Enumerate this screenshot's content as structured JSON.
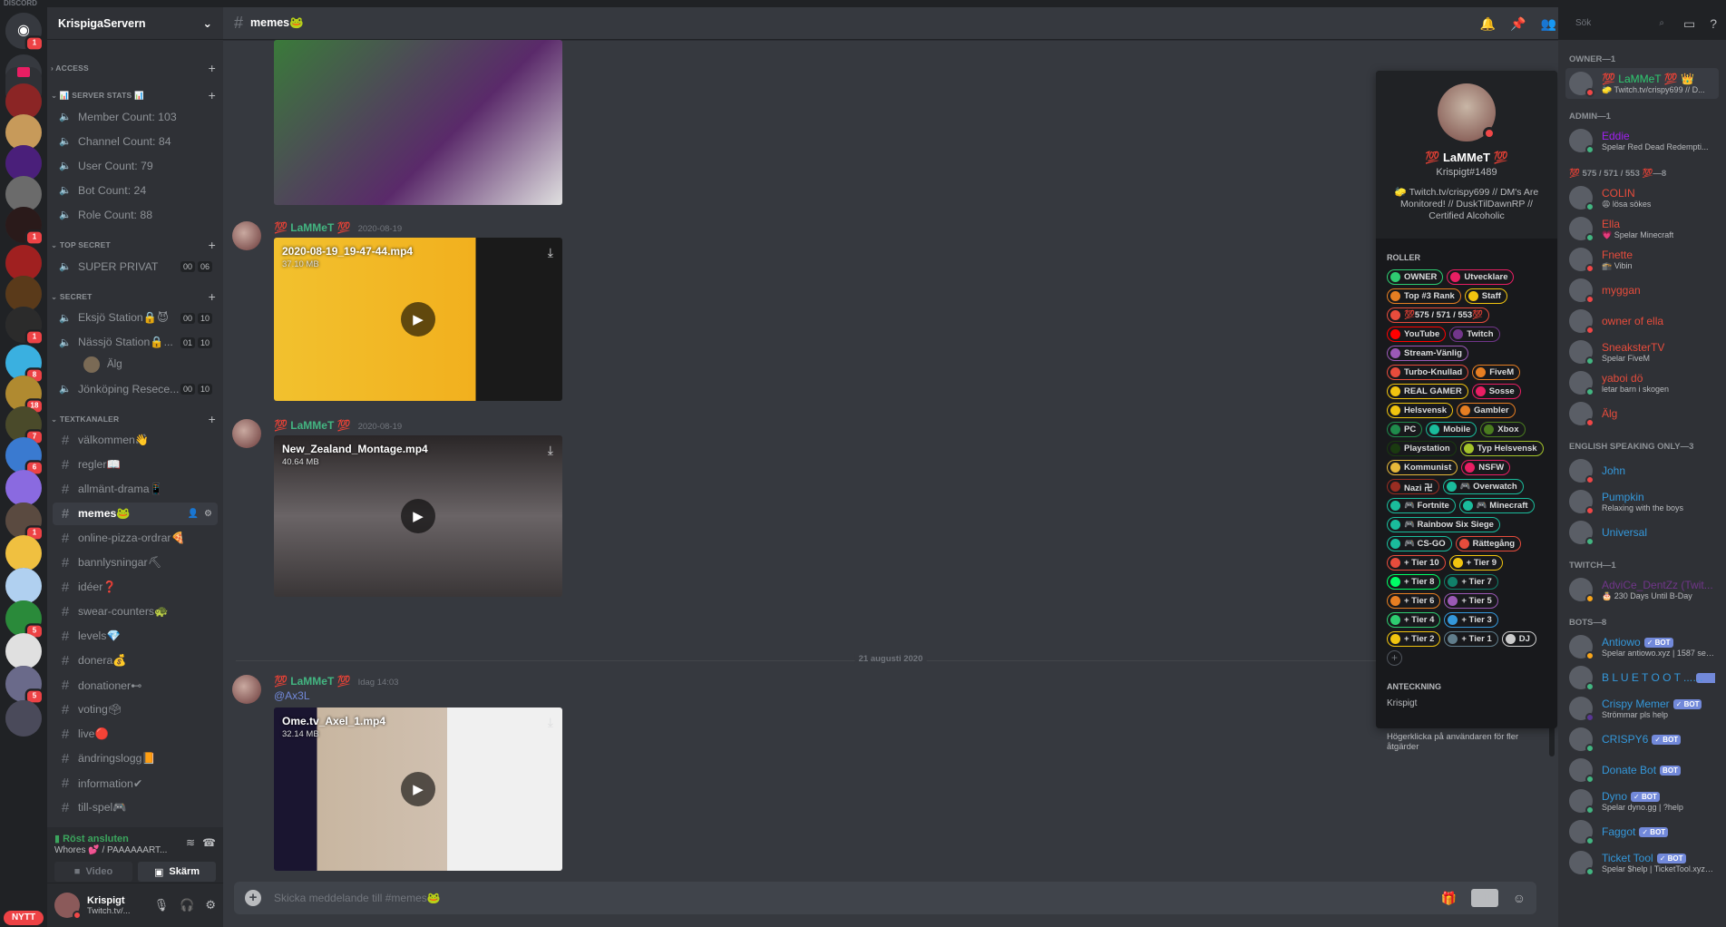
{
  "app": {
    "title": "DISCORD"
  },
  "guilds": [
    {
      "name": "home",
      "color": "#36393f",
      "badge": "1"
    },
    {
      "name": "folder",
      "color": "#e91e63",
      "badge": null
    },
    {
      "name": "server-red",
      "color": "#8b2525",
      "badge": null
    },
    {
      "name": "server-monkey",
      "color": "#c79a5a",
      "badge": null
    },
    {
      "name": "server-dusk",
      "color": "#4a1f7a",
      "badge": null
    },
    {
      "name": "server-car",
      "color": "#6b6b6b",
      "badge": null
    },
    {
      "name": "server-dark",
      "color": "#2a1a1a",
      "badge": "1"
    },
    {
      "name": "server-red2",
      "color": "#a02020",
      "badge": null
    },
    {
      "name": "server-bigboss",
      "color": "#5a3a1a",
      "badge": null
    },
    {
      "name": "server-tidepool",
      "color": "#2b2b2b",
      "badge": "1"
    },
    {
      "name": "server-lame",
      "color": "#3ab0e0",
      "badge": "8"
    },
    {
      "name": "server-ash",
      "color": "#b08a30",
      "badge": "18"
    },
    {
      "name": "server-shreks",
      "color": "#4a4a2a",
      "badge": "7"
    },
    {
      "name": "server-fortnite",
      "color": "#3a7ad0",
      "badge": "6"
    },
    {
      "name": "server-purple",
      "color": "#8a6ae0",
      "badge": null
    },
    {
      "name": "server-hand",
      "color": "#5a4a40",
      "badge": "1"
    },
    {
      "name": "server-sad",
      "color": "#f0c040",
      "badge": null
    },
    {
      "name": "server-blue",
      "color": "#b0d0f0",
      "badge": null
    },
    {
      "name": "server-monopoly",
      "color": "#2a8a3a",
      "badge": "5"
    },
    {
      "name": "server-rainbow",
      "color": "#e0e0e0",
      "badge": null
    },
    {
      "name": "server-ms",
      "color": "#6a6a8a",
      "badge": "5"
    },
    {
      "name": "server-dark2",
      "color": "#4a4a5a",
      "badge": null
    }
  ],
  "nytt_label": "NYTT",
  "server": {
    "name": "KrispigaServern"
  },
  "categories": [
    {
      "name": "ACCESS",
      "collapsed": true,
      "channels": []
    },
    {
      "name": "📊 SERVER STATS 📊",
      "collapsed": false,
      "channels": [
        {
          "type": "voice",
          "name": "Member Count: 103"
        },
        {
          "type": "voice",
          "name": "Channel Count: 84"
        },
        {
          "type": "voice",
          "name": "User Count: 79"
        },
        {
          "type": "voice",
          "name": "Bot Count: 24"
        },
        {
          "type": "voice",
          "name": "Role Count: 88"
        }
      ]
    },
    {
      "name": "TOP SECRET",
      "collapsed": false,
      "channels": [
        {
          "type": "voice",
          "name": "SUPER PRIVAT",
          "count_a": "00",
          "count_b": "06"
        }
      ]
    },
    {
      "name": "SECRET",
      "collapsed": false,
      "channels": [
        {
          "type": "voice",
          "name": "Eksjö Station🔒😈",
          "count_a": "00",
          "count_b": "10"
        },
        {
          "type": "voice",
          "name": "Nässjö Station🔒...",
          "count_a": "01",
          "count_b": "10",
          "users": [
            "Älg"
          ]
        },
        {
          "type": "voice",
          "name": "Jönköping Resece...",
          "count_a": "00",
          "count_b": "10"
        }
      ]
    },
    {
      "name": "TEXTKANALER",
      "collapsed": false,
      "channels": [
        {
          "type": "text",
          "name": "välkommen👋"
        },
        {
          "type": "text",
          "name": "regler📖"
        },
        {
          "type": "text",
          "name": "allmänt-drama📱"
        },
        {
          "type": "text",
          "name": "memes🐸",
          "active": true
        },
        {
          "type": "text",
          "name": "online-pizza-ordrar🍕"
        },
        {
          "type": "text",
          "name": "bannlysningar⛏"
        },
        {
          "type": "text",
          "name": "idéer❓"
        },
        {
          "type": "text",
          "name": "swear-counters🐢"
        },
        {
          "type": "text",
          "name": "levels💎"
        },
        {
          "type": "text",
          "name": "donera💰"
        },
        {
          "type": "text",
          "name": "donationer⊷"
        },
        {
          "type": "text",
          "name": "voting🗳"
        },
        {
          "type": "text",
          "name": "live🔴"
        },
        {
          "type": "text",
          "name": "ändringslogg📙"
        },
        {
          "type": "text",
          "name": "information✔"
        },
        {
          "type": "text",
          "name": "till-spel🎮"
        }
      ]
    }
  ],
  "voice_panel": {
    "status": "Röst ansluten",
    "channel": "Whores 💕 / PAAAAAART...",
    "video_label": "Video",
    "screen_label": "Skärm"
  },
  "user_panel": {
    "name": "Krispigt",
    "status": "Twitch.tv/..."
  },
  "channel_header": {
    "name": "memes🐸",
    "search_placeholder": "Sök"
  },
  "messages": [
    {
      "author": "💯 LaMMeT 💯",
      "timestamp": "2020-08-19",
      "attachment": {
        "filename": "2020-08-19_19-47-44.mp4",
        "size": "37.10 MB"
      }
    },
    {
      "author": "💯 LaMMeT 💯",
      "timestamp": "2020-08-19",
      "attachment": {
        "filename": "New_Zealand_Montage.mp4",
        "size": "40.64 MB"
      }
    },
    {
      "author": "💯 LaMMeT 💯",
      "timestamp": "Idag 14:03",
      "mention": "@Ax3L",
      "attachment": {
        "filename": "Ome.tv_Axel_1.mp4",
        "size": "32.14 MB"
      }
    }
  ],
  "date_divider": "21 augusti 2020",
  "composer": {
    "placeholder": "Skicka meddelande till #memes🐸"
  },
  "profile": {
    "name": "💯 LaMMeT 💯",
    "tag": "Krispigt#1489",
    "bio": "🧽 Twitch.tv/crispy699 // DM's Are Monitored! // DuskTilDawnRP // Certified Alcoholic",
    "roles_label": "ROLLER",
    "roles": [
      {
        "name": "OWNER",
        "color": "#2ecc71"
      },
      {
        "name": "Utvecklare",
        "color": "#e91e63"
      },
      {
        "name": "Top #3 Rank",
        "color": "#e67e22"
      },
      {
        "name": "Staff",
        "color": "#f1c40f"
      },
      {
        "name": "💯575 / 571 / 553💯",
        "color": "#e74c3c"
      },
      {
        "name": "YouTube",
        "color": "#ff0000"
      },
      {
        "name": "Twitch",
        "color": "#71368a"
      },
      {
        "name": "Stream-Vänlig",
        "color": "#9b59b6"
      },
      {
        "name": "Turbo-Knullad",
        "color": "#e74c3c"
      },
      {
        "name": "FiveM",
        "color": "#e67e22"
      },
      {
        "name": "REAL GAMER",
        "color": "#f1c40f"
      },
      {
        "name": "Sosse",
        "color": "#e91e63"
      },
      {
        "name": "Helsvensk",
        "color": "#f1c40f"
      },
      {
        "name": "Gambler",
        "color": "#e67e22"
      },
      {
        "name": "PC",
        "color": "#1f8b4c"
      },
      {
        "name": "Mobile",
        "color": "#1abc9c"
      },
      {
        "name": "Xbox",
        "color": "#4a7c1f"
      },
      {
        "name": "Playstation",
        "color": "#1a3a10"
      },
      {
        "name": "Typ Helsvensk",
        "color": "#a4c42a"
      },
      {
        "name": "Kommunist",
        "color": "#e6b83a"
      },
      {
        "name": "NSFW",
        "color": "#e91e63"
      },
      {
        "name": "Nazi 卍",
        "color": "#992d22"
      },
      {
        "name": "🎮 Overwatch",
        "color": "#1abc9c"
      },
      {
        "name": "🎮 Fortnite",
        "color": "#1abc9c"
      },
      {
        "name": "🎮 Minecraft",
        "color": "#1abc9c"
      },
      {
        "name": "🎮 Rainbow Six Siege",
        "color": "#1abc9c"
      },
      {
        "name": "🎮 CS-GO",
        "color": "#1abc9c"
      },
      {
        "name": "Rättegång",
        "color": "#e74c3c"
      },
      {
        "name": "+ Tier 10",
        "color": "#e74c3c"
      },
      {
        "name": "+ Tier 9",
        "color": "#f1c40f"
      },
      {
        "name": "+ Tier 8",
        "color": "#00ff66"
      },
      {
        "name": "+ Tier 7",
        "color": "#11806a"
      },
      {
        "name": "+ Tier 6",
        "color": "#e67e22"
      },
      {
        "name": "+ Tier 5",
        "color": "#9b59b6"
      },
      {
        "name": "+ Tier 4",
        "color": "#2ecc71"
      },
      {
        "name": "+ Tier 3",
        "color": "#3498db"
      },
      {
        "name": "+ Tier 2",
        "color": "#f1c40f"
      },
      {
        "name": "+ Tier 1",
        "color": "#607d8b"
      },
      {
        "name": "DJ",
        "color": "#cccccc"
      }
    ],
    "note_label": "ANTECKNING",
    "note": "Krispigt",
    "hint": "Högerklicka på användaren för fler åtgärder"
  },
  "member_groups": [
    {
      "name": "OWNER—1",
      "members": [
        {
          "name": "💯 LaMMeT 💯 👑",
          "color": "#2ecc71",
          "activity": "🧽 Twitch.tv/crispy699 // D...",
          "status": "dnd",
          "selected": true
        }
      ]
    },
    {
      "name": "ADMIN—1",
      "members": [
        {
          "name": "Eddie",
          "color": "#a020f0",
          "activity": "Spelar Red Dead Redempti...",
          "status": "online"
        }
      ]
    },
    {
      "name": "💯 575 / 571 / 553 💯—8",
      "members": [
        {
          "name": "COLIN",
          "color": "#e74c3c",
          "activity": "😩 lösa sökes",
          "status": "online"
        },
        {
          "name": "Ella",
          "color": "#e74c3c",
          "activity": "💗 Spelar Minecraft",
          "status": "online"
        },
        {
          "name": "Fnette",
          "color": "#e74c3c",
          "activity": "🕋 Vibin",
          "status": "dnd"
        },
        {
          "name": "myggan",
          "color": "#e74c3c",
          "activity": "",
          "status": "dnd"
        },
        {
          "name": "owner of ella",
          "color": "#e74c3c",
          "activity": "",
          "status": "dnd"
        },
        {
          "name": "SneaksterTV",
          "color": "#e74c3c",
          "activity": "Spelar FiveM",
          "status": "online"
        },
        {
          "name": "yaboi dö",
          "color": "#e74c3c",
          "activity": "letar barn i skogen",
          "status": "online"
        },
        {
          "name": "Älg",
          "color": "#e74c3c",
          "activity": "",
          "status": "dnd"
        }
      ]
    },
    {
      "name": "ENGLISH SPEAKING ONLY—3",
      "members": [
        {
          "name": "John",
          "color": "#3498db",
          "activity": "",
          "status": "dnd"
        },
        {
          "name": "Pumpkin",
          "color": "#3498db",
          "activity": "Relaxing with the boys",
          "status": "dnd"
        },
        {
          "name": "Universal",
          "color": "#3498db",
          "activity": "",
          "status": "online"
        }
      ]
    },
    {
      "name": "TWITCH—1",
      "members": [
        {
          "name": "AdviCe_DentZz (Twit...",
          "color": "#71368a",
          "activity": "🎂 230 Days Until B-Day",
          "status": "idle"
        }
      ]
    },
    {
      "name": "BOTS—8",
      "members": [
        {
          "name": "Antiowo",
          "color": "#3498db",
          "activity": "Spelar antiowo.xyz | 1587 serv...",
          "status": "idle",
          "bot": "✓ BOT"
        },
        {
          "name": "B L U E T O O T ...",
          "color": "#3498db",
          "activity": "",
          "status": "online",
          "bot": "✓ BOT"
        },
        {
          "name": "Crispy Memer",
          "color": "#3498db",
          "activity": "Strömmar pls help",
          "status": "stream",
          "bot": "✓ BOT"
        },
        {
          "name": "CRISPY6",
          "color": "#3498db",
          "activity": "",
          "status": "online",
          "bot": "✓ BOT"
        },
        {
          "name": "Donate Bot",
          "color": "#3498db",
          "activity": "",
          "status": "online",
          "bot": "BOT"
        },
        {
          "name": "Dyno",
          "color": "#3498db",
          "activity": "Spelar dyno.gg | ?help",
          "status": "online",
          "bot": "✓ BOT"
        },
        {
          "name": "Faggot",
          "color": "#3498db",
          "activity": "",
          "status": "online",
          "bot": "✓ BOT"
        },
        {
          "name": "Ticket Tool",
          "color": "#3498db",
          "activity": "Spelar $help | TicketTool.xyz | ...",
          "status": "online",
          "bot": "✓ BOT"
        }
      ]
    }
  ]
}
